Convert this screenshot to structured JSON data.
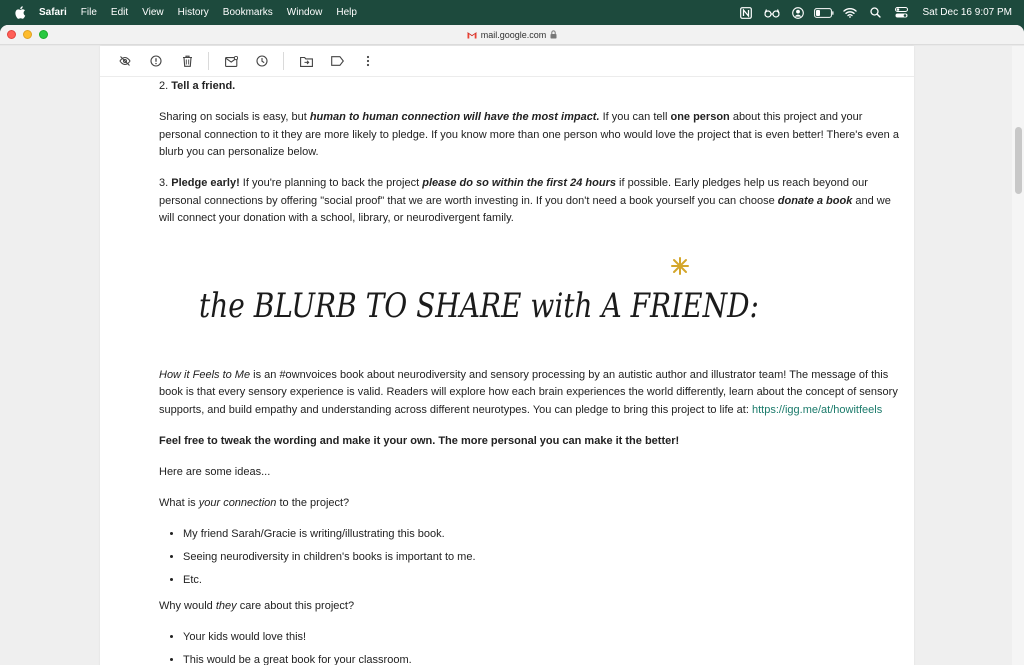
{
  "menubar": {
    "app_name": "Safari",
    "menus": [
      "File",
      "Edit",
      "View",
      "History",
      "Bookmarks",
      "Window",
      "Help"
    ],
    "clock": "Sat Dec 16  9:07 PM"
  },
  "browser": {
    "address": "mail.google.com"
  },
  "email": {
    "step2_label": "2.",
    "step2_title": "Tell a friend.",
    "p1_a": "Sharing on socials is easy, but ",
    "p1_b": "human to human connection will have the most impact.",
    "p1_c": " If you can tell ",
    "p1_d": "one person",
    "p1_e": " about this project and your personal connection to it they are more likely to pledge. If you know more than one person who would love the project that is even better! There's even a blurb you can personalize below.",
    "step3_label": "3.",
    "step3_title": "Pledge early!",
    "p3_a": " If you're planning to back the project ",
    "p3_b": "please do so within the first 24 hours",
    "p3_c": " if possible. Early pledges help us reach beyond our personal connections by offering \"social proof\" that we are worth investing in. If you don't need a book yourself you can choose ",
    "p3_d": "donate a book",
    "p3_e": " and we will connect your donation with a school, library, or neurodivergent family.",
    "banner_text": "the BLURB TO SHARE with A FRIEND:",
    "blurb_title": "How it Feels to Me",
    "blurb_body": " is an #ownvoices book about neurodiversity and sensory processing by an autistic author and illustrator team! The message of this book is that every sensory experience is valid. Readers will explore how each brain experiences the world differently, learn about the concept of sensory supports, and build empathy and understanding across different neurotypes. You can pledge to bring this project to life at: ",
    "blurb_link": "https://igg.me/at/howitfeels",
    "tweak": "Feel free to tweak the wording and make it your own. The more personal you can make it the better!",
    "ideas": "Here are some ideas...",
    "q1_a": "What is ",
    "q1_b": "your connection",
    "q1_c": " to the project?",
    "list1": [
      "My friend Sarah/Gracie is writing/illustrating this book.",
      "Seeing neurodiversity in children's books is important to me.",
      "Etc."
    ],
    "q2_a": "Why would ",
    "q2_b": "they",
    "q2_c": " care about this project?",
    "list2": [
      "Your kids would love this!",
      "This would be a great book for your classroom."
    ]
  },
  "icons": {
    "menubar_right": [
      "notion-icon",
      "glasses-icon",
      "user-icon",
      "battery-icon",
      "wifi-icon",
      "search-icon",
      "control-center-icon"
    ],
    "toolbar": [
      "report-spam-icon",
      "info-icon",
      "delete-icon",
      "mark-unread-icon",
      "snooze-icon",
      "move-to-icon",
      "label-icon",
      "more-icon"
    ]
  },
  "colors": {
    "menubar": "#1d4a3d",
    "link": "#1a7a6a",
    "star_accent": "#d4a62b"
  }
}
